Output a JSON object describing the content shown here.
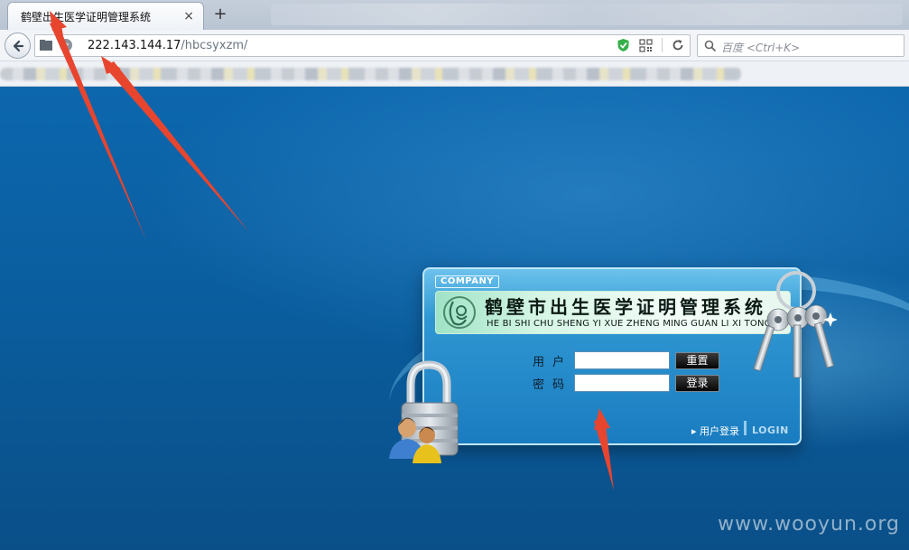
{
  "browser": {
    "tab_title": "鹤壁出生医学证明管理系统",
    "tab_close": "×",
    "new_tab": "+",
    "url_host": "222.143.144.17",
    "url_path": "/hbcsyxzm/",
    "search_placeholder": "百度 <Ctrl+K>"
  },
  "login_panel": {
    "company_badge": "COMPANY",
    "title": "鹤壁市出生医学证明管理系统",
    "title_pinyin": "HE BI SHI CHU SHENG YI XUE ZHENG MING GUAN LI XI TONG",
    "username_label": "用户",
    "password_label": "密码",
    "username_value": "",
    "password_value": "",
    "reset_button": "重置",
    "login_button": "登录",
    "user_login_link": "▸ 用户登录",
    "login_en": "LOGIN"
  },
  "watermark": "www.wooyun.org",
  "colors": {
    "page_bg": "#0b5a9a",
    "panel_bg": "#2f97d2",
    "annotation_arrow": "#e8452f"
  }
}
